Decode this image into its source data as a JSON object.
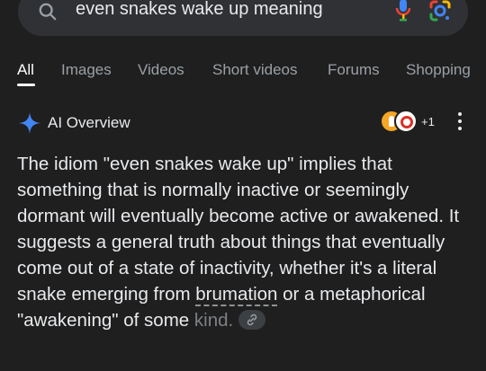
{
  "search": {
    "query": "even snakes wake up meaning"
  },
  "tabs": [
    {
      "label": "All",
      "active": true
    },
    {
      "label": "Images"
    },
    {
      "label": "Videos"
    },
    {
      "label": "Short videos"
    },
    {
      "label": "Forums"
    },
    {
      "label": "Shopping"
    }
  ],
  "ai_overview": {
    "title": "AI Overview",
    "source_count": "+1",
    "text_before": "The idiom \"even snakes wake up\" implies that something that is normally inactive or seemingly dormant will eventually become active or awakened. It suggests a general truth about things that eventually come out of a state of inactivity, whether it's a literal snake emerging from ",
    "term": "brumation",
    "text_after": " or a metaphorical \"awakening\" of some",
    "text_faded": "kind."
  },
  "icons": {
    "search": "search-icon",
    "mic": "mic-icon",
    "lens": "google-lens-icon",
    "spark": "ai-sparkle-icon",
    "more": "more-vert-icon",
    "link": "link-icon"
  },
  "colors": {
    "background": "#1f1f1f",
    "search_bg": "#303134",
    "text": "#e8eaed",
    "muted": "#9aa0a6",
    "spark": "#4285f4"
  }
}
